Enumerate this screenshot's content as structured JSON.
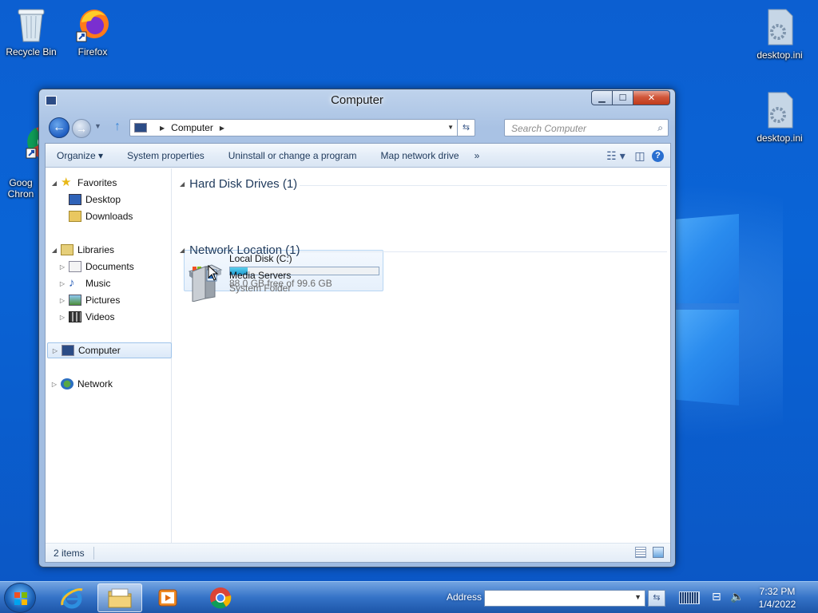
{
  "desktop": {
    "icons": [
      {
        "label": "Recycle Bin"
      },
      {
        "label": "Firefox"
      },
      {
        "label": "Goog\nChron"
      },
      {
        "label": "desktop.ini"
      },
      {
        "label": "desktop.ini"
      }
    ]
  },
  "window": {
    "title": "Computer",
    "nav": {
      "breadcrumb": "Computer",
      "search_placeholder": "Search Computer"
    },
    "toolbar": {
      "organize": "Organize ▾",
      "system_properties": "System properties",
      "uninstall": "Uninstall or change a program",
      "map_drive": "Map network drive",
      "more": "»"
    },
    "navpane": {
      "favorites": "Favorites",
      "desktop": "Desktop",
      "downloads": "Downloads",
      "libraries": "Libraries",
      "documents": "Documents",
      "music": "Music",
      "pictures": "Pictures",
      "videos": "Videos",
      "computer": "Computer",
      "network": "Network"
    },
    "content": {
      "hdd_group": "Hard Disk Drives (1)",
      "drive_name": "Local Disk (C:)",
      "drive_free": "88.0 GB free of 99.6 GB",
      "drive_used_fraction": 0.116,
      "net_group": "Network Location (1)",
      "media_name": "Media Servers",
      "media_type": "System Folder"
    },
    "status": {
      "items": "2 items"
    }
  },
  "taskbar": {
    "address_label": "Address",
    "time": "7:32 PM",
    "date": "1/4/2022"
  },
  "colors": {
    "desktop_blue": "#0a64d6",
    "drive_bar": "#1f9bd1"
  }
}
